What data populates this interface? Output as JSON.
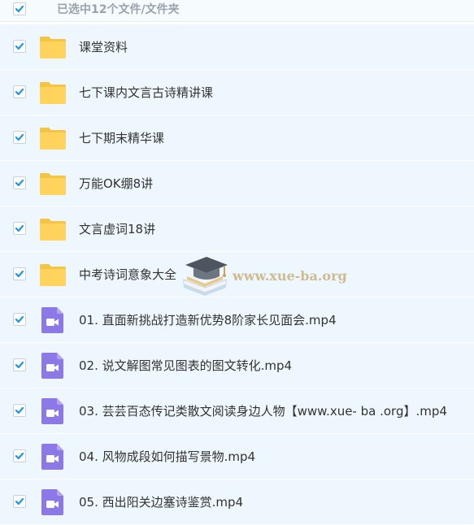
{
  "header": {
    "title": "已选中12个文件/文件夹",
    "select_all_checked": true
  },
  "colors": {
    "checkbox": "#1a98e8",
    "folder": "#ffd35c",
    "video": "#8c78e6",
    "row_bg": "#eef7fd"
  },
  "items": [
    {
      "type": "folder",
      "icon": "folder-icon",
      "label": "课堂资料",
      "checked": true
    },
    {
      "type": "folder",
      "icon": "folder-icon",
      "label": "七下课内文言古诗精讲课",
      "checked": true
    },
    {
      "type": "folder",
      "icon": "folder-icon",
      "label": "七下期末精华课",
      "checked": true
    },
    {
      "type": "folder",
      "icon": "folder-icon",
      "label": "万能OK绷8讲",
      "checked": true
    },
    {
      "type": "folder",
      "icon": "folder-icon",
      "label": "文言虚词18讲",
      "checked": true
    },
    {
      "type": "folder",
      "icon": "folder-icon",
      "label": "中考诗词意象大全",
      "checked": true
    },
    {
      "type": "video",
      "icon": "video-file-icon",
      "label": "01. 直面新挑战打造新优势8阶家长见面会.mp4",
      "checked": true
    },
    {
      "type": "video",
      "icon": "video-file-icon",
      "label": "02. 说文解图常见图表的图文转化.mp4",
      "checked": true
    },
    {
      "type": "video",
      "icon": "video-file-icon",
      "label": "03. 芸芸百态传记类散文阅读身边人物【www.xue- ba .org】.mp4",
      "checked": true
    },
    {
      "type": "video",
      "icon": "video-file-icon",
      "label": "04. 风物成段如何描写景物.mp4",
      "checked": true
    },
    {
      "type": "video",
      "icon": "video-file-icon",
      "label": "05. 西出阳关边塞诗鉴赏.mp4",
      "checked": true
    }
  ],
  "watermark": {
    "text": "www.xue-ba.org"
  }
}
